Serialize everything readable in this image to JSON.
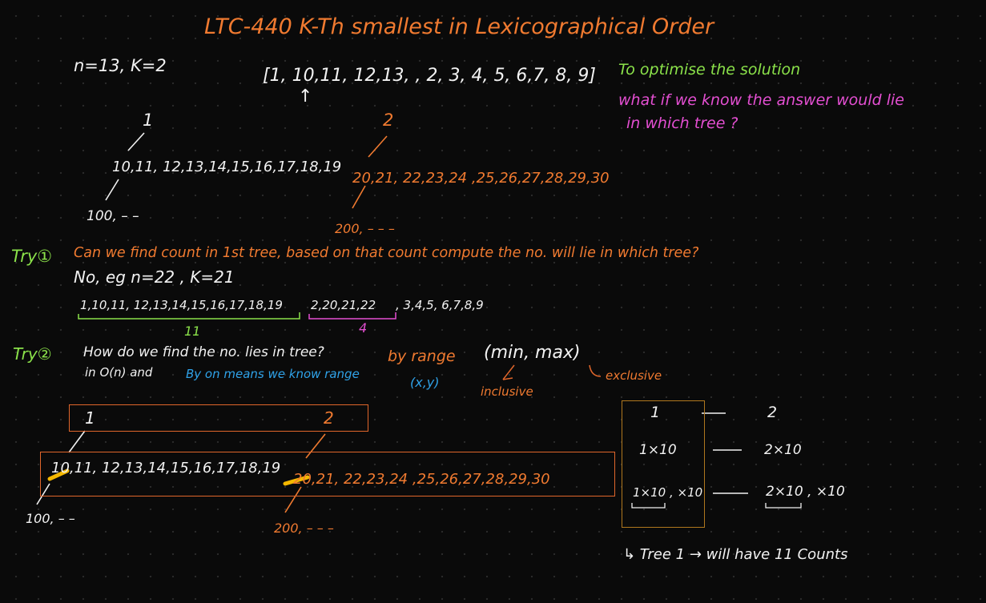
{
  "title": "LTC-440  K-Th  smallest in Lexicographical Order",
  "example": {
    "params": "n=13, K=2",
    "sorted_list": "[1, 10,11, 12,13, , 2, 3, 4, 5, 6,7, 8, 9]",
    "arrow": "↑"
  },
  "note": {
    "line1": "To optimise the solution",
    "line2": "what if we know the answer would lie",
    "line3": "in which tree ?"
  },
  "tree_top": {
    "root1": "1",
    "root2": "2",
    "children1": "10,11, 12,13,14,15,16,17,18,19",
    "children2": "20,21, 22,23,24 ,25,26,27,28,29,30",
    "grand1": "100, – –",
    "grand2": "200, – – –"
  },
  "try1": {
    "label": "Try①",
    "question": "Can we find count in 1st tree, based on that count compute the no. will lie in which tree?",
    "answer": "No,  eg   n=22 , K=21",
    "seq_green": "1,10,11, 12,13,14,15,16,17,18,19",
    "seq_pink": "2,20,21,22",
    "seq_rest": ", 3,4,5, 6,7,8,9",
    "count_green": "11",
    "count_pink": "4"
  },
  "try2": {
    "label": "Try②",
    "line1": "How do we find the no. lies in tree?",
    "by_range": "by range",
    "min_max": "(min, max)",
    "line2": "in O(n) and ",
    "line2_blue": "By on means we know range",
    "xy": "(x,y)",
    "inclusive": "inclusive",
    "exclusive": "exclusive"
  },
  "tree_bottom": {
    "root1": "1",
    "root2": "2",
    "children1": "10,11, 12,13,14,15,16,17,18,19",
    "children2": "20,21, 22,23,24 ,25,26,27,28,29,30",
    "grand1": "100, – –",
    "grand2": "200, – – –"
  },
  "range_table": {
    "rows": [
      {
        "left": "1",
        "right": "2"
      },
      {
        "left": "1×10",
        "right": "2×10"
      },
      {
        "left": "1×10 , ×10",
        "right": "2×10 , ×10"
      }
    ],
    "footer": "↳ Tree 1  → will have 11  Counts"
  },
  "colors": {
    "orange": "#f07a30",
    "white": "#f2f2f2",
    "green": "#8be24a",
    "pink": "#e44fd2",
    "blue": "#2fa2e8",
    "highlight": "#f5b800"
  }
}
